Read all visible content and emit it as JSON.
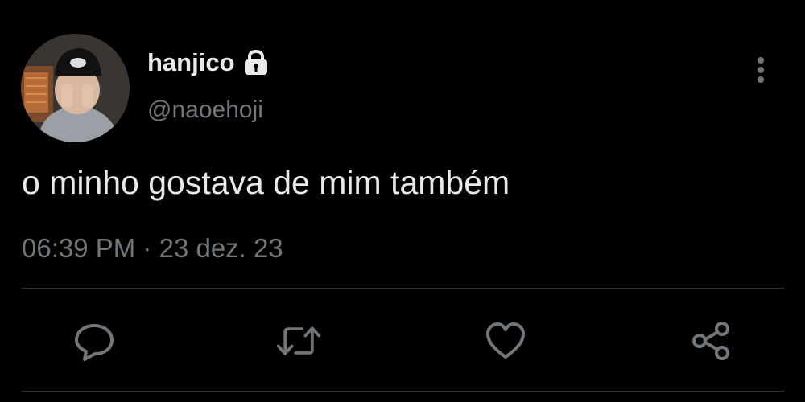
{
  "author": {
    "display_name": "hanjico",
    "username": "@naoehoji",
    "avatar_icon": "profile-photo",
    "protected_icon": "lock-icon"
  },
  "tweet": {
    "text": "o minho gostava de mim também",
    "time": "06:39 PM",
    "separator": "·",
    "date": "23 dez. 23"
  },
  "actions": [
    {
      "name": "reply",
      "icon": "reply-icon"
    },
    {
      "name": "retweet",
      "icon": "retweet-icon"
    },
    {
      "name": "like",
      "icon": "heart-icon"
    },
    {
      "name": "share",
      "icon": "share-icon"
    }
  ],
  "colors": {
    "background": "#000000",
    "primary_text": "#e7e9ea",
    "secondary_text": "#71767b",
    "divider": "#2f3336"
  }
}
